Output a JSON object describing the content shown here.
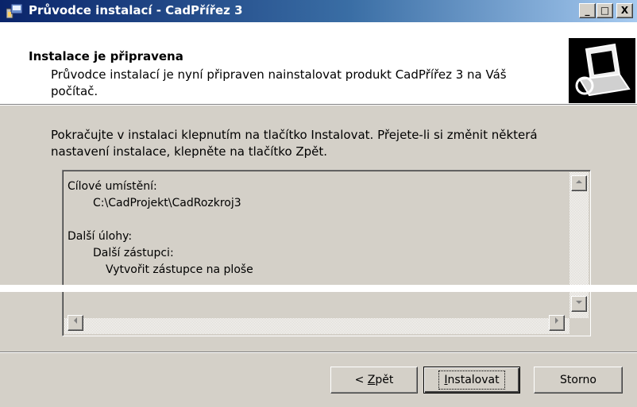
{
  "window": {
    "title": "Průvodce instalací - CadPřířez 3",
    "controls": {
      "minimize": "_",
      "maximize": "□",
      "close": "X"
    }
  },
  "header": {
    "title": "Instalace je připravena",
    "description": "Průvodce instalací je nyní připraven nainstalovat produkt CadPřířez 3 na Váš počítač."
  },
  "body": {
    "instructions": "Pokračujte v instalaci klepnutím na tlačítko Instalovat. Přejete-li si změnit některá nastavení instalace, klepněte na tlačítko Zpět."
  },
  "memo": {
    "lines": [
      {
        "text": "Cílové umístění:",
        "indent": 0
      },
      {
        "text": "C:\\CadProjekt\\CadRozkroj3",
        "indent": 1
      },
      {
        "text": "",
        "indent": 0
      },
      {
        "text": "Další úlohy:",
        "indent": 0
      },
      {
        "text": "Další zástupci:",
        "indent": 1
      },
      {
        "text": "Vytvořit zástupce na ploše",
        "indent": 2
      }
    ]
  },
  "buttons": {
    "back_prefix": "< ",
    "back_accel": "Z",
    "back_rest": "pět",
    "install_accel": "I",
    "install_rest": "nstalovat",
    "cancel": "Storno"
  },
  "icons": {
    "app": "installer-icon",
    "logo": "computer-install-icon",
    "scroll_up": "arrow-up-icon",
    "scroll_down": "arrow-down-icon",
    "scroll_left": "arrow-left-icon",
    "scroll_right": "arrow-right-icon"
  }
}
